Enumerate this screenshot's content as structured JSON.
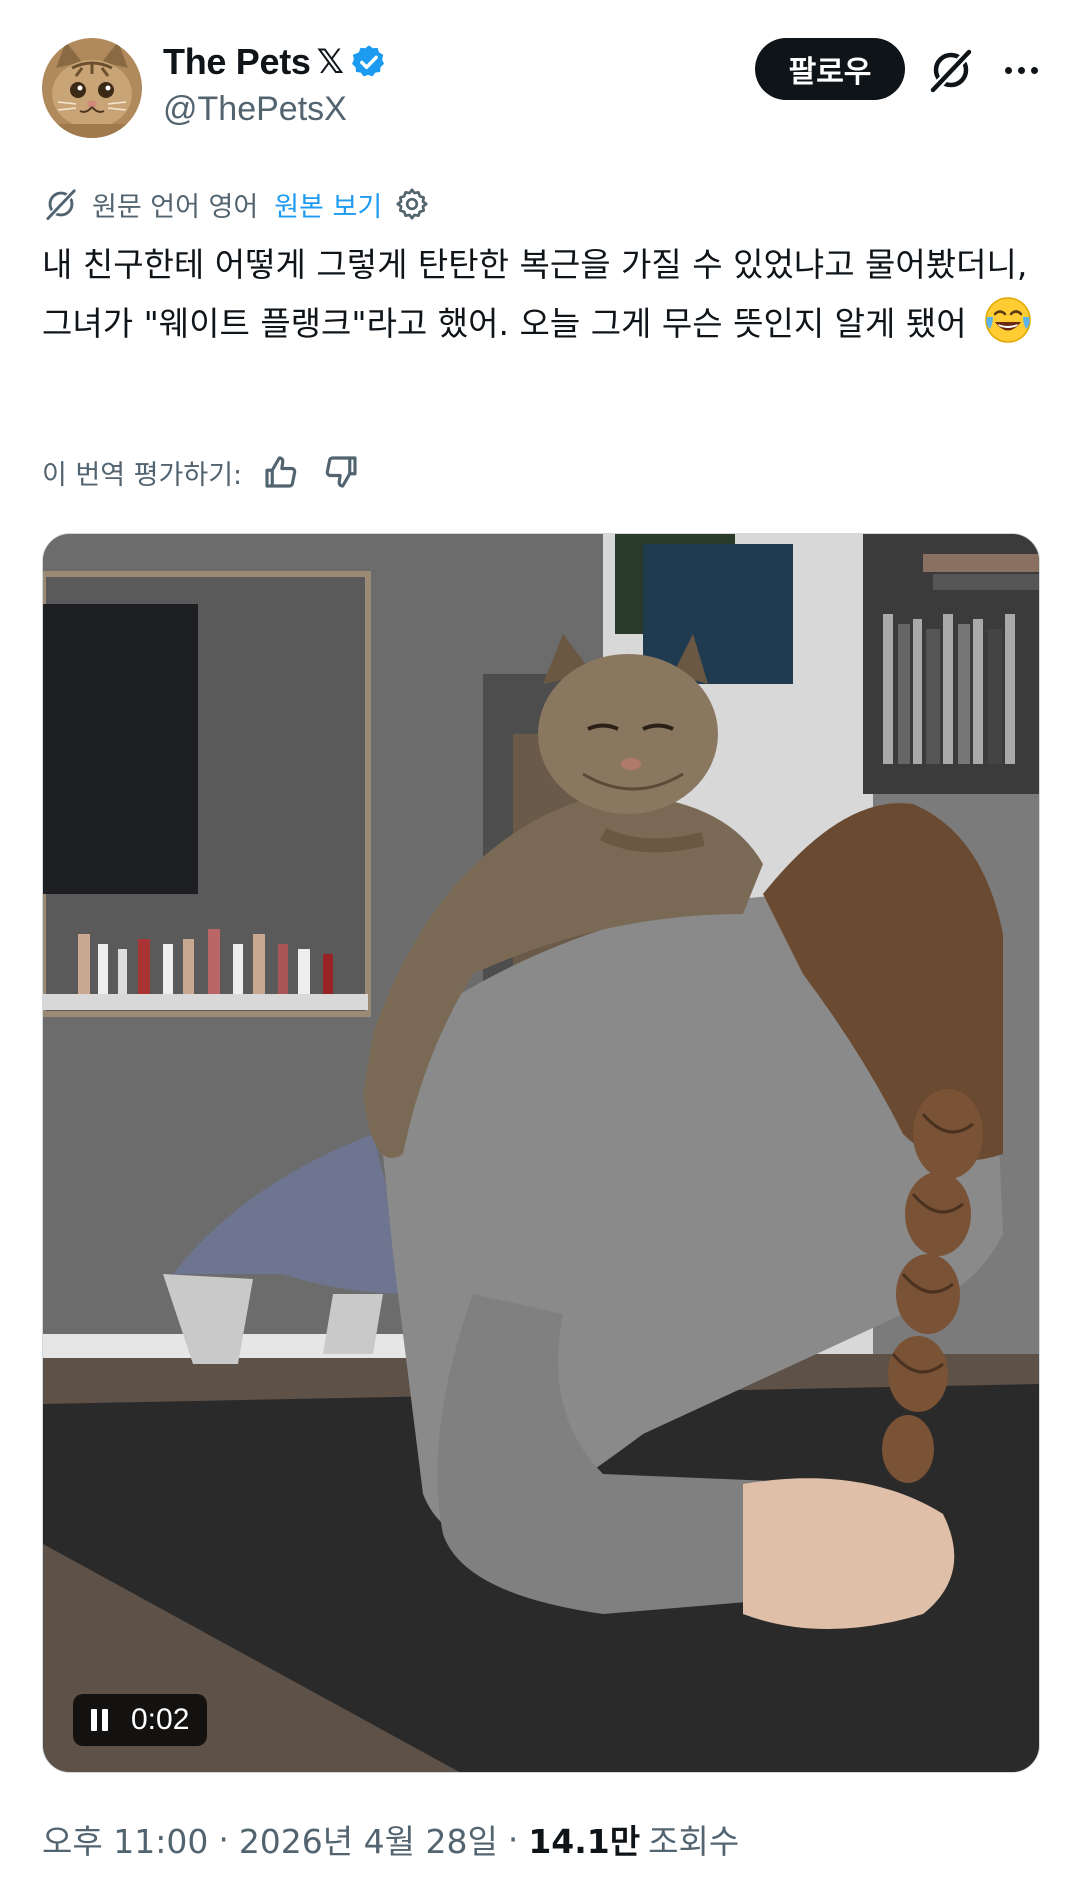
{
  "author": {
    "display_name": "The Pets",
    "x_badge": "𝕏",
    "handle": "@ThePetsX",
    "avatar_icon": "cat-face-avatar",
    "verified_color": "#1d9bf0"
  },
  "actions": {
    "follow_label": "팔로우",
    "grok_icon": "grok-icon",
    "more_icon": "more-icon"
  },
  "translation": {
    "label": "원문 언어 영어",
    "show_original": "원본 보기",
    "settings_icon": "gear-icon"
  },
  "tweet": {
    "text": "내 친구한테 어떻게 그렇게 탄탄한 복근을 가질 수 있었냐고 물어봤더니, 그녀가 \"웨이트 플랭크\"라고 했어. 오늘 그게 무슨 뜻인지 알게 됐어",
    "emoji": "face-with-tears-of-joy"
  },
  "rating": {
    "label": "이 번역 평가하기:",
    "thumbs_up_icon": "thumbs-up-icon",
    "thumbs_down_icon": "thumbs-down-icon"
  },
  "media": {
    "type": "video",
    "elapsed": "0:02",
    "state_icon": "pause-icon"
  },
  "meta": {
    "time": "오후 11:00",
    "date": "2026년 4월 28일",
    "separator": "·",
    "views_count": "14.1만",
    "views_label": "조회수"
  },
  "colors": {
    "text_primary": "#0f1419",
    "text_secondary": "#536471",
    "accent": "#1d9bf0"
  }
}
